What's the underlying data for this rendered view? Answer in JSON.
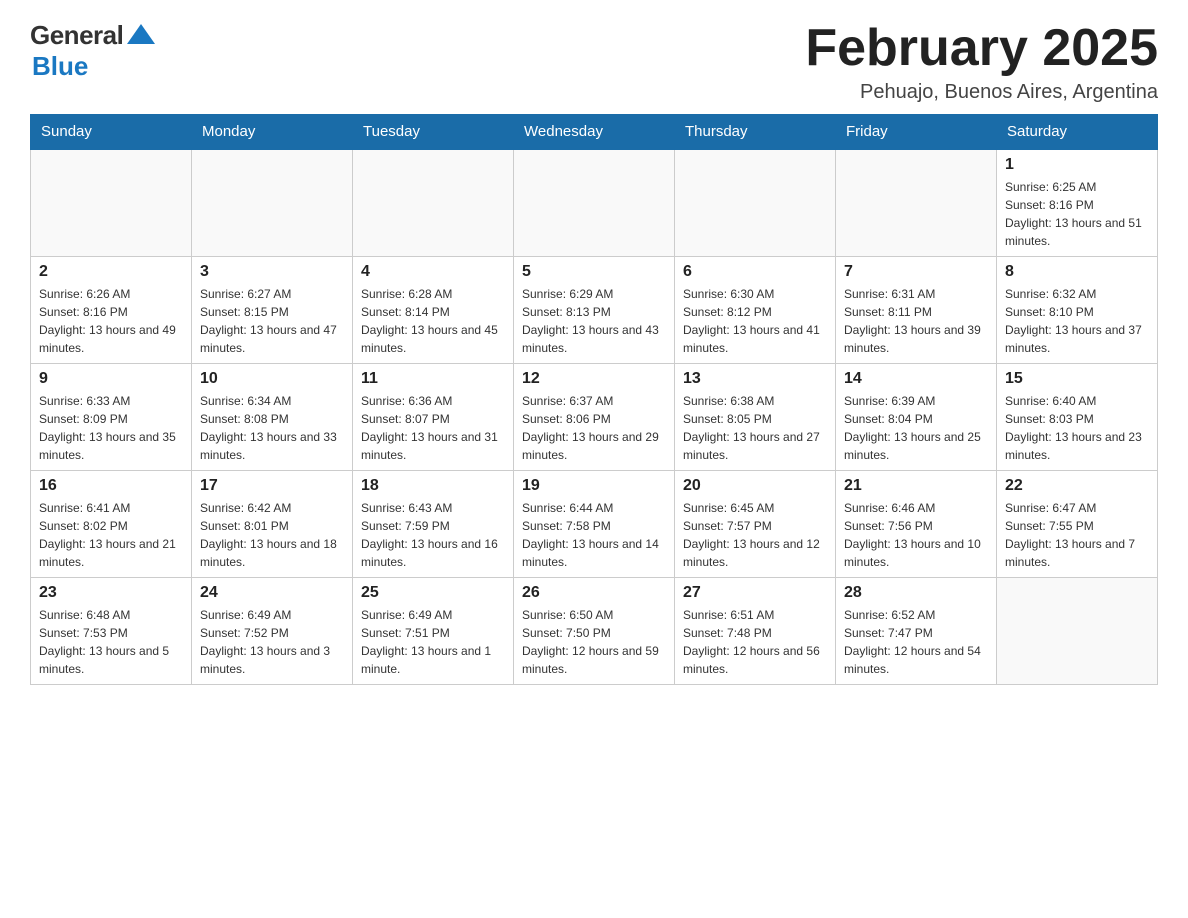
{
  "header": {
    "logo_general": "General",
    "logo_blue": "Blue",
    "title": "February 2025",
    "subtitle": "Pehuajo, Buenos Aires, Argentina"
  },
  "weekdays": [
    "Sunday",
    "Monday",
    "Tuesday",
    "Wednesday",
    "Thursday",
    "Friday",
    "Saturday"
  ],
  "weeks": [
    [
      {
        "day": "",
        "info": ""
      },
      {
        "day": "",
        "info": ""
      },
      {
        "day": "",
        "info": ""
      },
      {
        "day": "",
        "info": ""
      },
      {
        "day": "",
        "info": ""
      },
      {
        "day": "",
        "info": ""
      },
      {
        "day": "1",
        "info": "Sunrise: 6:25 AM\nSunset: 8:16 PM\nDaylight: 13 hours and 51 minutes."
      }
    ],
    [
      {
        "day": "2",
        "info": "Sunrise: 6:26 AM\nSunset: 8:16 PM\nDaylight: 13 hours and 49 minutes."
      },
      {
        "day": "3",
        "info": "Sunrise: 6:27 AM\nSunset: 8:15 PM\nDaylight: 13 hours and 47 minutes."
      },
      {
        "day": "4",
        "info": "Sunrise: 6:28 AM\nSunset: 8:14 PM\nDaylight: 13 hours and 45 minutes."
      },
      {
        "day": "5",
        "info": "Sunrise: 6:29 AM\nSunset: 8:13 PM\nDaylight: 13 hours and 43 minutes."
      },
      {
        "day": "6",
        "info": "Sunrise: 6:30 AM\nSunset: 8:12 PM\nDaylight: 13 hours and 41 minutes."
      },
      {
        "day": "7",
        "info": "Sunrise: 6:31 AM\nSunset: 8:11 PM\nDaylight: 13 hours and 39 minutes."
      },
      {
        "day": "8",
        "info": "Sunrise: 6:32 AM\nSunset: 8:10 PM\nDaylight: 13 hours and 37 minutes."
      }
    ],
    [
      {
        "day": "9",
        "info": "Sunrise: 6:33 AM\nSunset: 8:09 PM\nDaylight: 13 hours and 35 minutes."
      },
      {
        "day": "10",
        "info": "Sunrise: 6:34 AM\nSunset: 8:08 PM\nDaylight: 13 hours and 33 minutes."
      },
      {
        "day": "11",
        "info": "Sunrise: 6:36 AM\nSunset: 8:07 PM\nDaylight: 13 hours and 31 minutes."
      },
      {
        "day": "12",
        "info": "Sunrise: 6:37 AM\nSunset: 8:06 PM\nDaylight: 13 hours and 29 minutes."
      },
      {
        "day": "13",
        "info": "Sunrise: 6:38 AM\nSunset: 8:05 PM\nDaylight: 13 hours and 27 minutes."
      },
      {
        "day": "14",
        "info": "Sunrise: 6:39 AM\nSunset: 8:04 PM\nDaylight: 13 hours and 25 minutes."
      },
      {
        "day": "15",
        "info": "Sunrise: 6:40 AM\nSunset: 8:03 PM\nDaylight: 13 hours and 23 minutes."
      }
    ],
    [
      {
        "day": "16",
        "info": "Sunrise: 6:41 AM\nSunset: 8:02 PM\nDaylight: 13 hours and 21 minutes."
      },
      {
        "day": "17",
        "info": "Sunrise: 6:42 AM\nSunset: 8:01 PM\nDaylight: 13 hours and 18 minutes."
      },
      {
        "day": "18",
        "info": "Sunrise: 6:43 AM\nSunset: 7:59 PM\nDaylight: 13 hours and 16 minutes."
      },
      {
        "day": "19",
        "info": "Sunrise: 6:44 AM\nSunset: 7:58 PM\nDaylight: 13 hours and 14 minutes."
      },
      {
        "day": "20",
        "info": "Sunrise: 6:45 AM\nSunset: 7:57 PM\nDaylight: 13 hours and 12 minutes."
      },
      {
        "day": "21",
        "info": "Sunrise: 6:46 AM\nSunset: 7:56 PM\nDaylight: 13 hours and 10 minutes."
      },
      {
        "day": "22",
        "info": "Sunrise: 6:47 AM\nSunset: 7:55 PM\nDaylight: 13 hours and 7 minutes."
      }
    ],
    [
      {
        "day": "23",
        "info": "Sunrise: 6:48 AM\nSunset: 7:53 PM\nDaylight: 13 hours and 5 minutes."
      },
      {
        "day": "24",
        "info": "Sunrise: 6:49 AM\nSunset: 7:52 PM\nDaylight: 13 hours and 3 minutes."
      },
      {
        "day": "25",
        "info": "Sunrise: 6:49 AM\nSunset: 7:51 PM\nDaylight: 13 hours and 1 minute."
      },
      {
        "day": "26",
        "info": "Sunrise: 6:50 AM\nSunset: 7:50 PM\nDaylight: 12 hours and 59 minutes."
      },
      {
        "day": "27",
        "info": "Sunrise: 6:51 AM\nSunset: 7:48 PM\nDaylight: 12 hours and 56 minutes."
      },
      {
        "day": "28",
        "info": "Sunrise: 6:52 AM\nSunset: 7:47 PM\nDaylight: 12 hours and 54 minutes."
      },
      {
        "day": "",
        "info": ""
      }
    ]
  ]
}
